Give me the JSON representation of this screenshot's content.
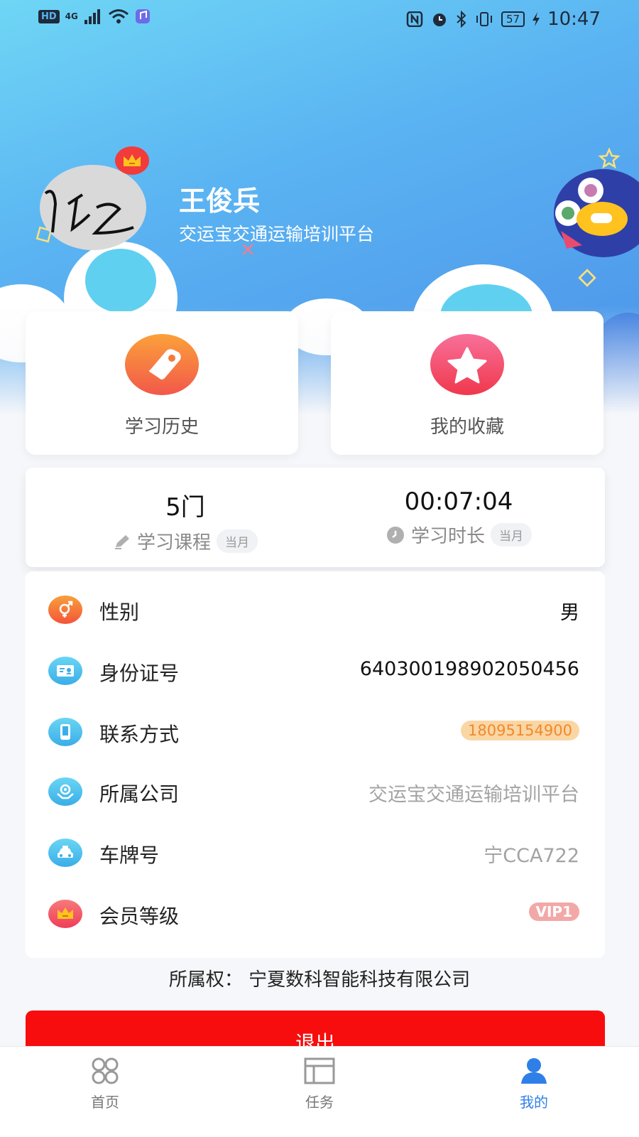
{
  "status_bar": {
    "network_badge": "HD",
    "signal_label": "4G",
    "time": "10:47",
    "battery": "57"
  },
  "profile": {
    "name": "王俊兵",
    "organization": "交运宝交通运输培训平台"
  },
  "quick_actions": [
    {
      "label": "学习历史",
      "icon": "tag-icon",
      "color": "#fb7a3c"
    },
    {
      "label": "我的收藏",
      "icon": "star-icon",
      "color": "#f2486a"
    }
  ],
  "stats": {
    "courses": {
      "value": "5门",
      "label": "学习课程",
      "period": "当月"
    },
    "duration": {
      "value": "00:07:04",
      "label": "学习时长",
      "period": "当月"
    }
  },
  "info": {
    "gender": {
      "label": "性别",
      "value": "男",
      "icon": "gender-icon"
    },
    "id_number": {
      "label": "身份证号",
      "value": "640300198902050456",
      "icon": "id-card-icon"
    },
    "contact": {
      "label": "联系方式",
      "value": "18095154900",
      "icon": "phone-icon"
    },
    "company": {
      "label": "所属公司",
      "value": "交运宝交通运输培训平台",
      "icon": "company-icon"
    },
    "plate": {
      "label": "车牌号",
      "value": "宁CCA722",
      "icon": "car-icon"
    },
    "membership": {
      "label": "会员等级",
      "value": "VIP1",
      "icon": "crown-icon"
    }
  },
  "copyright": "所属权：  宁夏数科智能科技有限公司",
  "logout_label": "退出",
  "nav": [
    {
      "label": "首页",
      "icon": "home-grid-icon",
      "active": false
    },
    {
      "label": "任务",
      "icon": "task-icon",
      "active": false
    },
    {
      "label": "我的",
      "icon": "user-icon",
      "active": true
    }
  ],
  "colors": {
    "accent": "#2f7fe8",
    "logout": "#f70d0d",
    "header_top": "#6fd6f5",
    "header_bottom": "#4a8fe8"
  }
}
